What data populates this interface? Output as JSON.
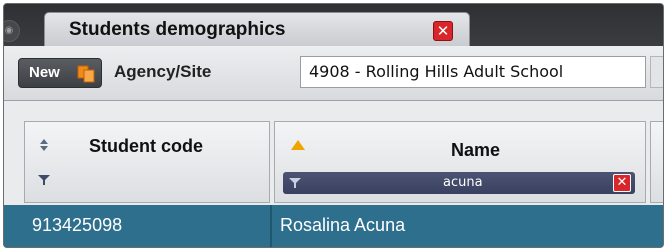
{
  "tab": {
    "title": "Students demographics",
    "close_glyph": "✕"
  },
  "toolbar": {
    "new_label": "New",
    "new_icon": "copy-icon",
    "agency_label": "Agency/Site",
    "agency_value": "4908 - Rolling Hills Adult School"
  },
  "grid": {
    "columns": [
      {
        "label": "Student code",
        "sort_icon": "sort-both-icon",
        "filter_icon": "filter-icon"
      },
      {
        "label": "Name",
        "sort_icon": "sort-ascending-icon",
        "filter_value": "acuna",
        "filter_clear_glyph": "✕"
      }
    ],
    "rows": [
      {
        "code": "913425098",
        "name": "Rosalina Acuna"
      }
    ]
  },
  "colors": {
    "window_bg": "#3a3c40",
    "tab_close": "#d9262b",
    "selected_row": "#2d6f8d",
    "filter_bg": "#434a6a",
    "sort_accent": "#f0a400"
  }
}
